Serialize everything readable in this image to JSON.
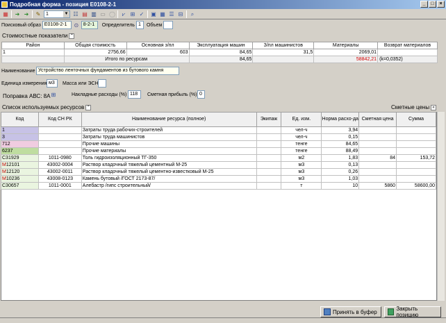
{
  "window": {
    "title": "Подробная форма - позиция Е0108-2-1",
    "win_min": "_",
    "win_max": "□",
    "win_close": "×"
  },
  "toolbar": {
    "level_value": "1"
  },
  "search": {
    "label": "Поисковый образ",
    "value1": "Е0108-2-1",
    "value2": "8-2-1",
    "determinant_label": "Определитель",
    "determinant_value": "1",
    "volume_label": "Объем",
    "volume_value": ""
  },
  "cost": {
    "header": "Стоимостные показатели",
    "columns": [
      "Район",
      "Общая стоимость",
      "Основная з/пл",
      "Эксплуатация машин",
      "З/пл машинистов",
      "Материалы",
      "Возврат материалов"
    ],
    "row": [
      "1",
      "2756,66",
      "603",
      "84,65",
      "31,5",
      "2069,01",
      ""
    ],
    "total_label": "Итого по ресурсам",
    "total_machines": "84,65",
    "total_materials": "58842,21",
    "total_coef": "(k=0,0352)"
  },
  "name": {
    "label": "Наименование",
    "value": "Устройство ленточных фундаментов из бутового камня"
  },
  "unit": {
    "label": "Единица измерения",
    "value": "м3",
    "esn_label": "Масса или ЭСН",
    "esn_value": ""
  },
  "abc": {
    "label": "Поправка АВС: 8А",
    "overhead_label": "Накладные расходы (%)",
    "overhead_value": "118",
    "profit_label": "Сметная прибыль (%)",
    "profit_value": "0"
  },
  "resources": {
    "header": "Список используемых ресурсов",
    "prices_label": "Сметные цены",
    "columns": [
      "Код",
      "Код СН РК",
      "Наименование ресурса (полное)",
      "Экипаж",
      "Ед. изм.",
      "Норма расхо-да",
      "Сметная цена",
      "Сумма"
    ],
    "rows": [
      {
        "code": "1",
        "snrk": "",
        "name": "Затраты труда рабочих-строителей",
        "crew": "",
        "unit": "чел-ч",
        "norm": "3,94",
        "price": "",
        "sum": "",
        "cls": "code-blue"
      },
      {
        "code": "3",
        "snrk": "",
        "name": "Затраты труда машинистов",
        "crew": "",
        "unit": "чел-ч",
        "norm": "0,15",
        "price": "",
        "sum": "",
        "cls": "code-blue"
      },
      {
        "code": "712",
        "snrk": "",
        "name": "Прочие машины",
        "crew": "",
        "unit": "тенге",
        "norm": "84,65",
        "price": "",
        "sum": "",
        "cls": "code-pink"
      },
      {
        "code": "6237",
        "snrk": "",
        "name": "Прочие материалы",
        "crew": "",
        "unit": "тенге",
        "norm": "88,49",
        "price": "",
        "sum": "",
        "cls": "code-green"
      },
      {
        "code": "С31929",
        "snrk": "1011-0980",
        "name": "Толь гидроизоляционный ТГ-350",
        "crew": "",
        "unit": "м2",
        "norm": "1,83",
        "price": "84",
        "sum": "153,72",
        "cls": "code-lt"
      },
      {
        "code": "М12101",
        "snrk": "43002-0004",
        "name": "Раствор кладочный тяжелый цементный М-25",
        "crew": "",
        "unit": "м3",
        "norm": "0,13",
        "price": "",
        "sum": "",
        "cls": "code-lt"
      },
      {
        "code": "М12120",
        "snrk": "43002-0011",
        "name": "Раствор кладочный тяжелый цементно-известковый М-25",
        "crew": "",
        "unit": "м3",
        "norm": "0,26",
        "price": "",
        "sum": "",
        "cls": "code-lt"
      },
      {
        "code": "М10236",
        "snrk": "43008-0123",
        "name": "Камень бутовый /ГОСТ 2173-87/",
        "crew": "",
        "unit": "м3",
        "norm": "1,03",
        "price": "",
        "sum": "",
        "cls": "code-lt"
      },
      {
        "code": "С30657",
        "snrk": "1011-0001",
        "name": "Алебастр /гипс строительный/",
        "crew": "",
        "unit": "т",
        "norm": "10",
        "price": "5860",
        "sum": "58600,00",
        "cls": "code-lt"
      }
    ]
  },
  "buttons": {
    "accept": "Принять в буфер",
    "close": "Закрыть позицию"
  }
}
